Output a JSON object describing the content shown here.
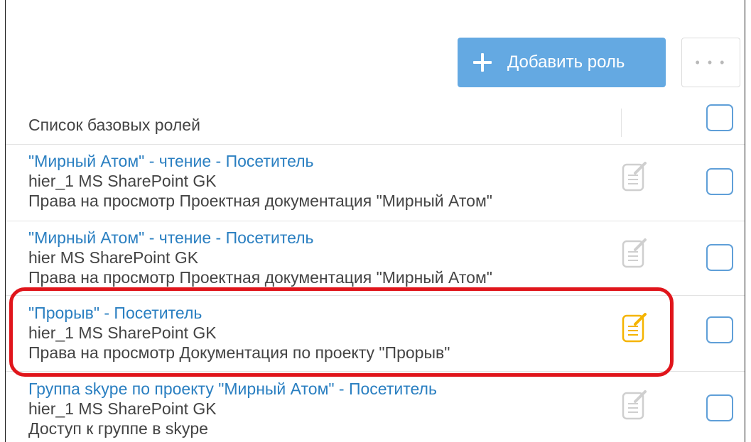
{
  "toolbar": {
    "add_role_label": "Добавить роль",
    "more_label": "• • •"
  },
  "list": {
    "header_title": "Список базовых ролей",
    "rows": [
      {
        "title": "\"Мирный Атом\" - чтение - Посетитель",
        "line1": "hier_1 MS SharePoint GK",
        "line2": "Права на просмотр Проектная документация \"Мирный Атом\"",
        "edit_icon": "edit-document-icon",
        "edit_icon_color": "#cfcfcf"
      },
      {
        "title": "\"Мирный Атом\" - чтение - Посетитель",
        "line1": "hier MS SharePoint GK",
        "line2": "Права на просмотр Проектная документация \"Мирный Атом\"",
        "edit_icon": "edit-document-icon",
        "edit_icon_color": "#cfcfcf"
      },
      {
        "title": "\"Прорыв\" - Посетитель",
        "line1": "hier_1 MS SharePoint GK",
        "line2": "Права на просмотр Документация по проекту \"Прорыв\"",
        "edit_icon": "edit-document-icon",
        "edit_icon_color": "#f5b400",
        "highlighted": true
      },
      {
        "title": "Группа skype по проекту \"Мирный Атом\" - Посетитель",
        "line1": "hier_1 MS SharePoint GK",
        "line2": "Доступ к группе в skype",
        "edit_icon": "edit-document-icon",
        "edit_icon_color": "#cfcfcf"
      }
    ]
  },
  "colors": {
    "accent": "#64a9e2",
    "link": "#2a7fc1",
    "text": "#444444",
    "checkbox_border": "#5f9fd8",
    "highlight": "#e0151b"
  }
}
